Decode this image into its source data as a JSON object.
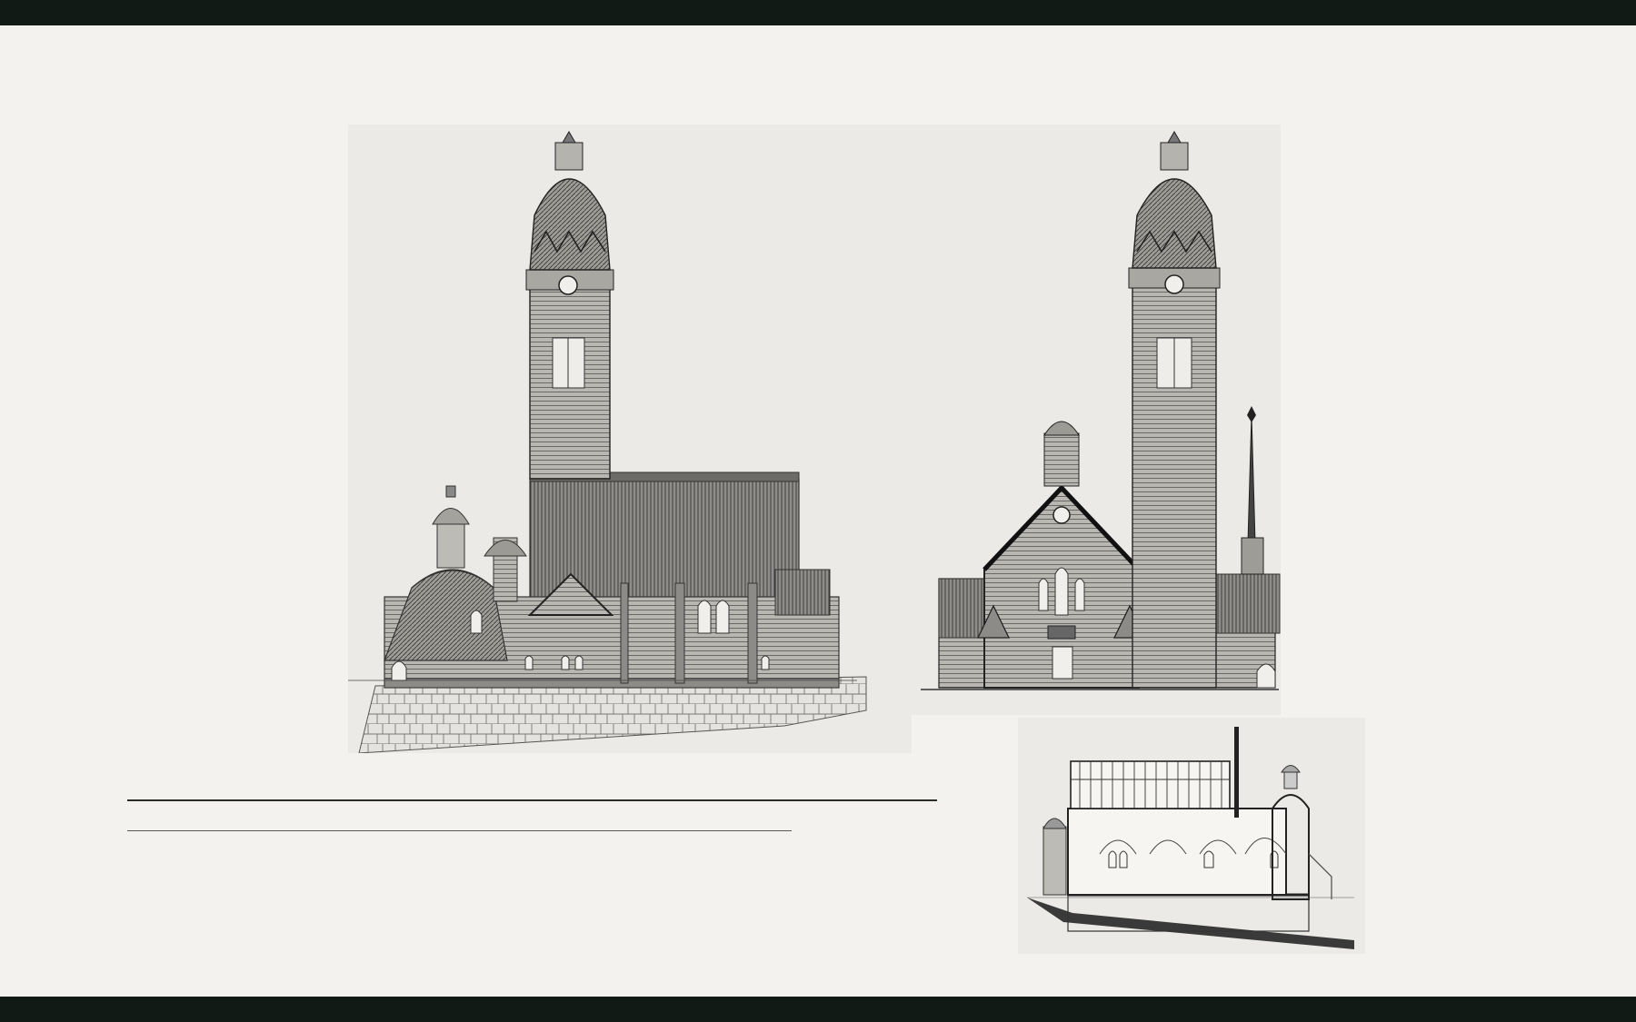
{
  "slide": {
    "background_color": "#f3f2ee",
    "bar_color": "#111a15",
    "drawings": {
      "side_elevation": {
        "icon": "church-side-elevation-drawing"
      },
      "front_elevation": {
        "icon": "church-front-elevation-drawing"
      },
      "cross_section": {
        "icon": "church-cross-section-drawing"
      }
    },
    "heading_line": "",
    "subheading_line": ""
  }
}
